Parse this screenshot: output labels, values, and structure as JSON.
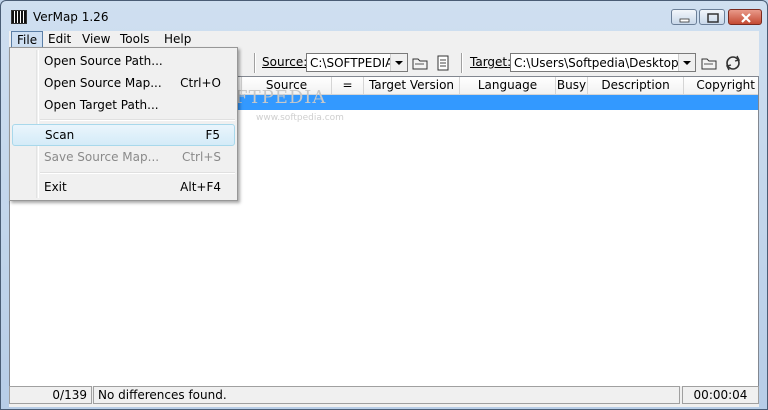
{
  "window": {
    "title": "VerMap 1.26"
  },
  "menubar": {
    "items": [
      "File",
      "Edit",
      "View",
      "Tools",
      "Help"
    ]
  },
  "file_menu": {
    "items": [
      {
        "label": "Open Source Path...",
        "shortcut": ""
      },
      {
        "label": "Open Source Map...",
        "shortcut": "Ctrl+O"
      },
      {
        "label": "Open Target Path...",
        "shortcut": ""
      },
      {
        "label": "Scan",
        "shortcut": "F5",
        "highlighted": true
      },
      {
        "label": "Save Source Map...",
        "shortcut": "Ctrl+S",
        "disabled": true
      },
      {
        "label": "Exit",
        "shortcut": "Alt+F4"
      }
    ]
  },
  "toolbar": {
    "source_label": "Source:",
    "source_value": "C:\\SOFTPEDIA",
    "target_label": "Target:",
    "target_value": "C:\\Users\\Softpedia\\Desktop",
    "icons": [
      "open-folder-icon",
      "document-icon",
      "open-folder-icon",
      "refresh-icon"
    ]
  },
  "list": {
    "columns": [
      "Source Version",
      "=",
      "Target Version",
      "Language",
      "Busy",
      "Description",
      "Copyright"
    ],
    "selection_color": "#3399ff"
  },
  "watermark": {
    "text": "SOFTPEDIA",
    "url": "www.softpedia.com"
  },
  "statusbar": {
    "count": "0/139",
    "message": "No differences found.",
    "time": "00:00:04"
  }
}
